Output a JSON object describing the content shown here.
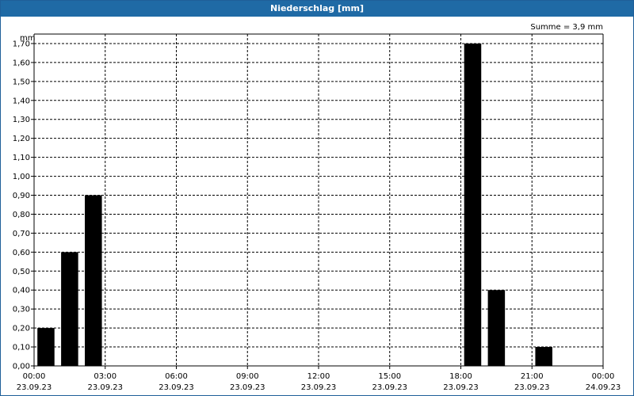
{
  "window": {
    "title": "Niederschlag [mm]"
  },
  "chart_data": {
    "type": "bar",
    "title": "Niederschlag [mm]",
    "ylabel": "mm",
    "summary": "Summe = 3,9 mm",
    "ylim": [
      0,
      1.75
    ],
    "yticks": [
      "0,00",
      "0,10",
      "0,20",
      "0,30",
      "0,40",
      "0,50",
      "0,60",
      "0,70",
      "0,80",
      "0,90",
      "1,00",
      "1,10",
      "1,20",
      "1,30",
      "1,40",
      "1,50",
      "1,60",
      "1,70"
    ],
    "xlim_hours": [
      0,
      24
    ],
    "xticks": [
      {
        "time": "00:00",
        "date": "23.09.23"
      },
      {
        "time": "03:00",
        "date": "23.09.23"
      },
      {
        "time": "06:00",
        "date": "23.09.23"
      },
      {
        "time": "09:00",
        "date": "23.09.23"
      },
      {
        "time": "12:00",
        "date": "23.09.23"
      },
      {
        "time": "15:00",
        "date": "23.09.23"
      },
      {
        "time": "18:00",
        "date": "23.09.23"
      },
      {
        "time": "21:00",
        "date": "23.09.23"
      },
      {
        "time": "00:00",
        "date": "24.09.23"
      }
    ],
    "bars": [
      {
        "hour": 0,
        "value": 0.2
      },
      {
        "hour": 1,
        "value": 0.6
      },
      {
        "hour": 2,
        "value": 0.9
      },
      {
        "hour": 18,
        "value": 1.7
      },
      {
        "hour": 19,
        "value": 0.4
      },
      {
        "hour": 21,
        "value": 0.1
      }
    ],
    "bar_color": "#000000",
    "grid": true
  }
}
